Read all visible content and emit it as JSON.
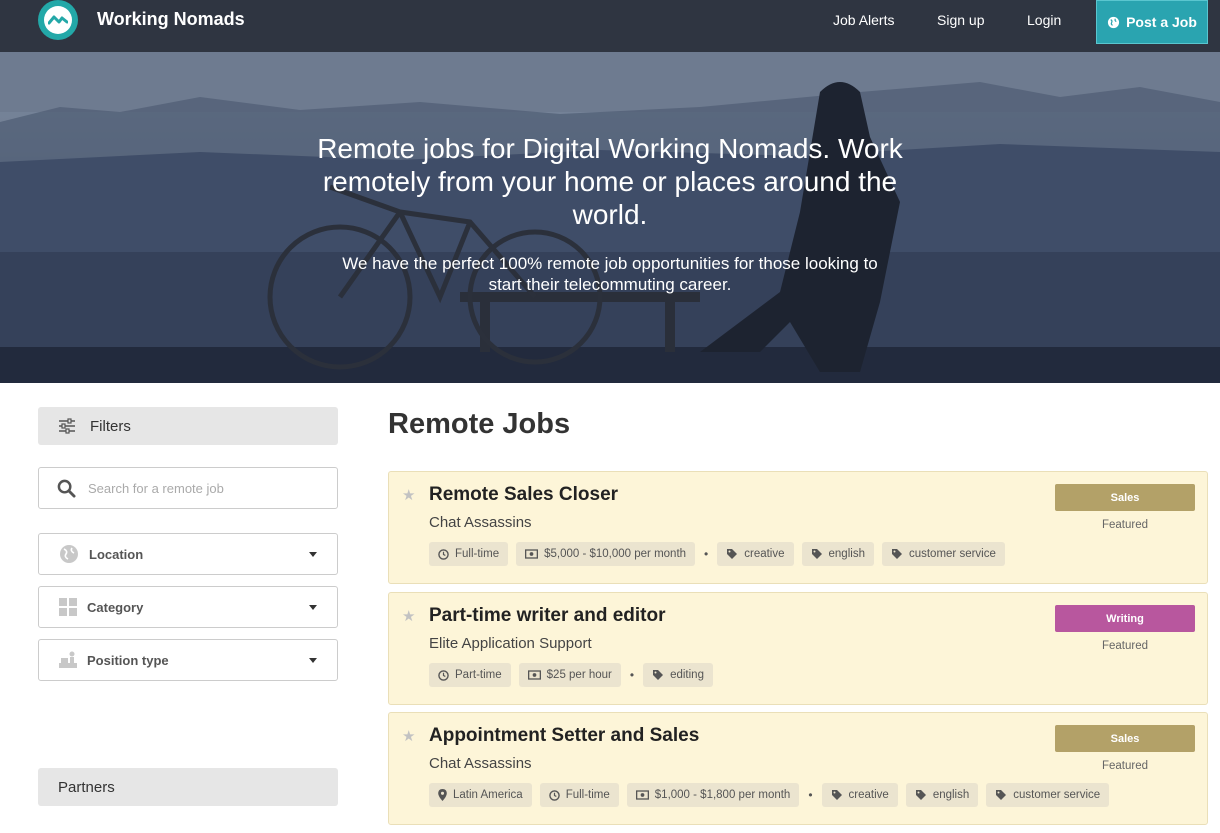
{
  "header": {
    "brand": "Working Nomads",
    "nav": {
      "job_alerts": "Job Alerts",
      "sign_up": "Sign up",
      "login": "Login"
    },
    "post_job": "Post a Job"
  },
  "hero": {
    "title": "Remote jobs for Digital Working Nomads. Work remotely from your home or places around the world.",
    "subtitle": "We have the perfect 100% remote job opportunities for those looking to start their telecommuting career."
  },
  "sidebar": {
    "filters_label": "Filters",
    "search_placeholder": "Search for a remote job",
    "location_label": "Location",
    "category_label": "Category",
    "position_type_label": "Position type",
    "partners_label": "Partners"
  },
  "main": {
    "title": "Remote Jobs",
    "jobs": [
      {
        "title": "Remote Sales Closer",
        "company": "Chat Assassins",
        "category": "Sales",
        "featured": "Featured",
        "type": "Full-time",
        "salary": "$5,000 - $10,000 per month",
        "tags": [
          "creative",
          "english",
          "customer service"
        ]
      },
      {
        "title": "Part-time writer and editor",
        "company": "Elite Application Support",
        "category": "Writing",
        "featured": "Featured",
        "type": "Part-time",
        "salary": "$25 per hour",
        "tags": [
          "editing"
        ]
      },
      {
        "title": "Appointment Setter and Sales",
        "company": "Chat Assassins",
        "category": "Sales",
        "featured": "Featured",
        "location": "Latin America",
        "type": "Full-time",
        "salary": "$1,000 - $1,800 per month",
        "tags": [
          "creative",
          "english",
          "customer service"
        ]
      }
    ]
  },
  "colors": {
    "header_bg": "#2f3541",
    "accent": "#2aa4b0",
    "job_bg": "#fdf5d8",
    "sales_badge": "#b3a168",
    "writing_badge": "#b8579e"
  }
}
